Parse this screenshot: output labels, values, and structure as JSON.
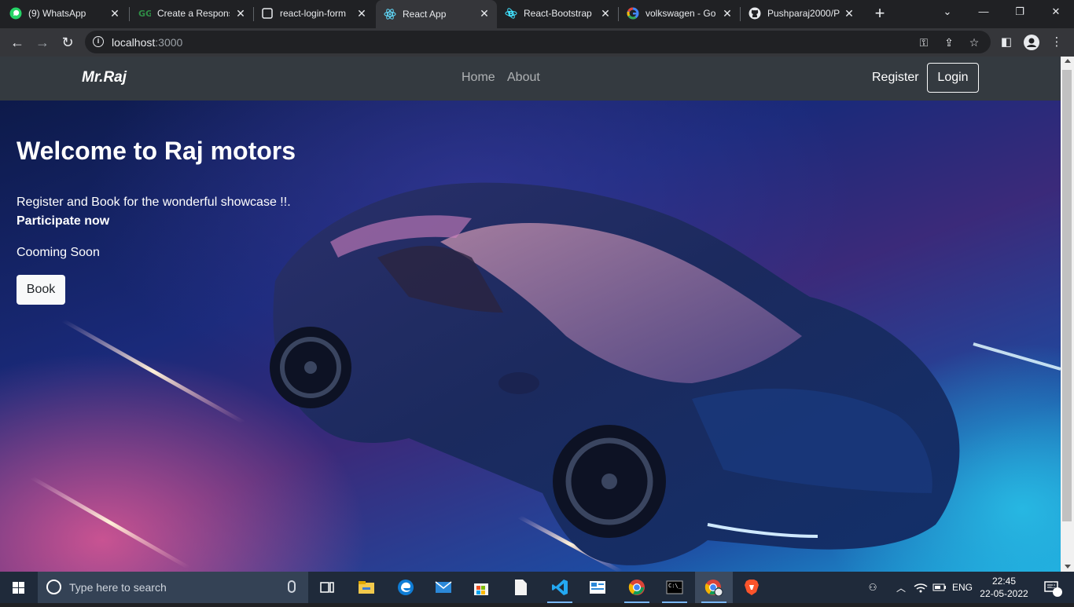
{
  "browser": {
    "tabs": [
      {
        "title": "(9) WhatsApp",
        "icon": "whatsapp-icon",
        "active": false
      },
      {
        "title": "Create a Respons",
        "icon": "gfg-icon",
        "active": false
      },
      {
        "title": "react-login-form",
        "icon": "page-icon",
        "active": false
      },
      {
        "title": "React App",
        "icon": "react-icon",
        "active": true
      },
      {
        "title": "React-Bootstrap",
        "icon": "bootstrap-icon",
        "active": false
      },
      {
        "title": "volkswagen - Go",
        "icon": "google-icon",
        "active": false
      },
      {
        "title": "Pushparaj2000/P",
        "icon": "github-icon",
        "active": false
      }
    ],
    "url_host": "localhost",
    "url_port": ":3000"
  },
  "site": {
    "brand": "Mr.Raj",
    "nav": {
      "home": "Home",
      "about": "About"
    },
    "register": "Register",
    "login": "Login"
  },
  "hero": {
    "title": "Welcome to Raj motors",
    "lead": "Register and Book for the wonderful showcase !!.",
    "emphasis": "Participate now",
    "status": "Cooming Soon",
    "button": "Book"
  },
  "taskbar": {
    "search_placeholder": "Type here to search",
    "language": "ENG",
    "time": "22:45",
    "date": "22-05-2022",
    "notification_count": "1"
  },
  "colors": {
    "navbar": "#343a40",
    "chrome_dark": "#202124",
    "chrome_toolbar": "#35363a",
    "taskbar": "#1f2a3a"
  }
}
